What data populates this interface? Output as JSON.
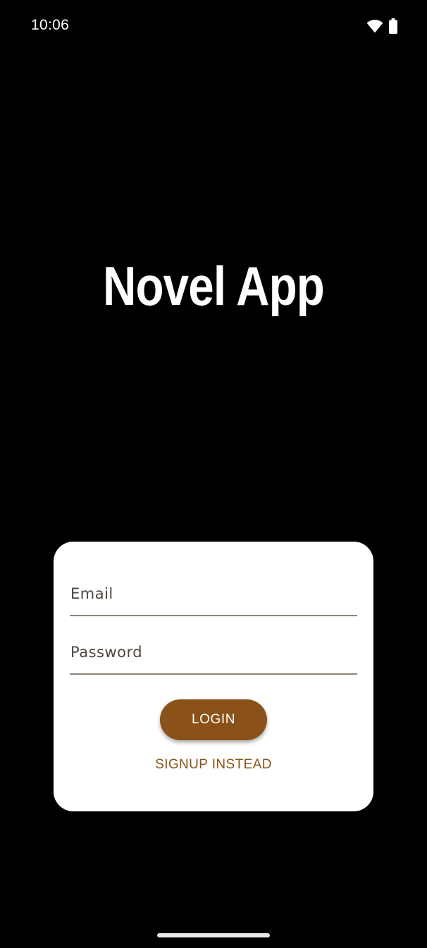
{
  "status_bar": {
    "time": "10:06",
    "icons": [
      "wifi-icon",
      "battery-icon"
    ]
  },
  "app": {
    "title": "Novel App"
  },
  "login_form": {
    "email_placeholder": "Email",
    "password_placeholder": "Password",
    "email_value": "",
    "password_value": "",
    "login_label": "LOGIN",
    "signup_label": "SIGNUP INSTEAD"
  },
  "colors": {
    "background": "#000000",
    "card": "#ffffff",
    "accent": "#8a5218",
    "underline": "#8d8378"
  }
}
